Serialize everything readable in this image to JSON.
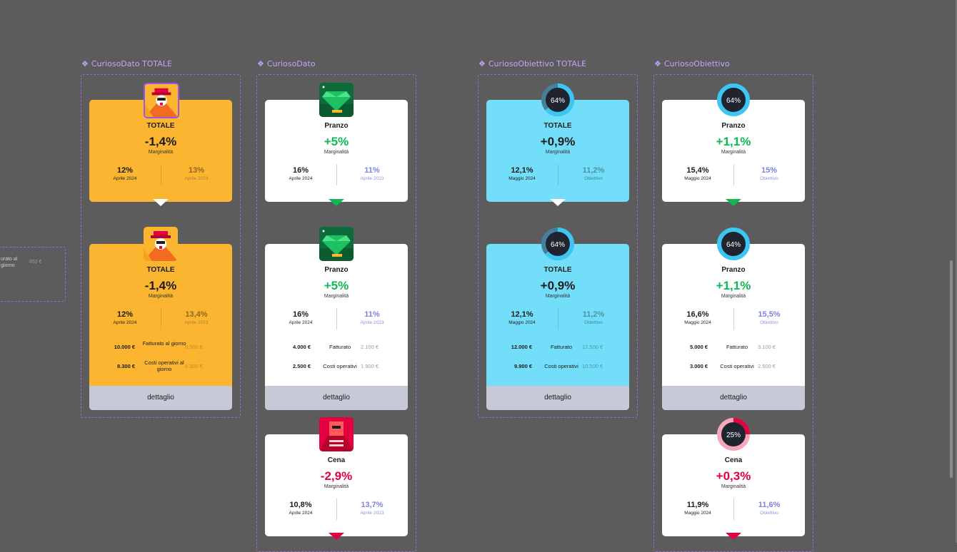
{
  "frames": [
    {
      "label": "CuriosoDato TOTALE"
    },
    {
      "label": "CuriosoDato"
    },
    {
      "label": "CuriosoObiettivo TOTALE"
    },
    {
      "label": "CuriosoObiettivo"
    }
  ],
  "left_box": {
    "text1": "urato al\ngiorno",
    "text2": "850 €"
  },
  "cards": {
    "dato_totale_small": {
      "name": "TOTALE",
      "big": "-1,4%",
      "sub": "Marginalità",
      "l_value": "12%",
      "l_label": "Aprile 2024",
      "r_value": "13%",
      "r_label": "Aprile 2023"
    },
    "dato_totale_full": {
      "name": "TOTALE",
      "big": "-1,4%",
      "sub": "Marginalità",
      "l_value": "12%",
      "l_label": "Aprile 2024",
      "r_value": "13,4%",
      "r_label": "Aprile 2023",
      "rows": [
        {
          "a": "10.000 €",
          "b": "Fatturato al giorno",
          "c": "8.500 €"
        },
        {
          "a": "8.300 €",
          "b": "Costi operativi al giorno",
          "c": "6.300 €"
        }
      ],
      "footer": "dettaglio"
    },
    "dato_pranzo_small": {
      "name": "Pranzo",
      "big": "+5%",
      "sub": "Marginalità",
      "l_value": "16%",
      "l_label": "Aprile 2024",
      "r_value": "11%",
      "r_label": "Aprile 2023"
    },
    "dato_pranzo_full": {
      "name": "Pranzo",
      "big": "+5%",
      "sub": "Marginalità",
      "l_value": "16%",
      "l_label": "Aprile 2024",
      "r_value": "11%",
      "r_label": "Aprile 2023",
      "rows": [
        {
          "a": "4.000 €",
          "b": "Fatturato",
          "c": "2.100 €"
        },
        {
          "a": "2.500 €",
          "b": "Costi operativi",
          "c": "1.900 €"
        }
      ],
      "footer": "dettaglio"
    },
    "dato_cena_small": {
      "name": "Cena",
      "big": "-2,9%",
      "sub": "Marginalità",
      "l_value": "10,8%",
      "l_label": "Aprile 2024",
      "r_value": "13,7%",
      "r_label": "Aprile 2023"
    },
    "obj_totale_small": {
      "name": "TOTALE",
      "big": "+0,9%",
      "sub": "Marginalità",
      "l_value": "12,1%",
      "l_label": "Maggio 2024",
      "r_value": "11,2%",
      "r_label": "Obiettivo",
      "ring": "64%"
    },
    "obj_totale_full": {
      "name": "TOTALE",
      "big": "+0,9%",
      "sub": "Marginalità",
      "l_value": "12,1%",
      "l_label": "Maggio 2024",
      "r_value": "11,2%",
      "r_label": "Obiettivo",
      "ring": "64%",
      "rows": [
        {
          "a": "12.000 €",
          "b": "Fatturato",
          "c": "12.500 €"
        },
        {
          "a": "9.900 €",
          "b": "Costi operativi",
          "c": "10.500 €"
        }
      ],
      "footer": "dettaglio"
    },
    "obj_pranzo_small": {
      "name": "Pranzo",
      "big": "+1,1%",
      "sub": "Marginalità",
      "l_value": "15,4%",
      "l_label": "Maggio 2024",
      "r_value": "15%",
      "r_label": "Obiettivo",
      "ring": "64%"
    },
    "obj_pranzo_full": {
      "name": "Pranzo",
      "big": "+1,1%",
      "sub": "Marginalità",
      "l_value": "16,6%",
      "l_label": "Maggio 2024",
      "r_value": "15,5%",
      "r_label": "Obiettivo",
      "ring": "64%",
      "rows": [
        {
          "a": "5.000 €",
          "b": "Fatturato",
          "c": "3.100 €"
        },
        {
          "a": "3.000 €",
          "b": "Costi operativi",
          "c": "2.500 €"
        }
      ],
      "footer": "dettaglio"
    },
    "obj_cena_small": {
      "name": "Cena",
      "big": "+0,3%",
      "sub": "Marginalità",
      "l_value": "11,9%",
      "l_label": "Maggio 2024",
      "r_value": "11,6%",
      "r_label": "Obiettivo",
      "ring": "25%"
    }
  },
  "colors": {
    "orange": "#fbb530",
    "cyan": "#72def9",
    "green": "#10b853",
    "red": "#e5003f",
    "frame": "#8e6bd6"
  },
  "icons": {
    "totale": "detective-icon",
    "pranzo": "gem-icon",
    "cena": "robot-icon",
    "ring": "progress-ring-icon"
  }
}
